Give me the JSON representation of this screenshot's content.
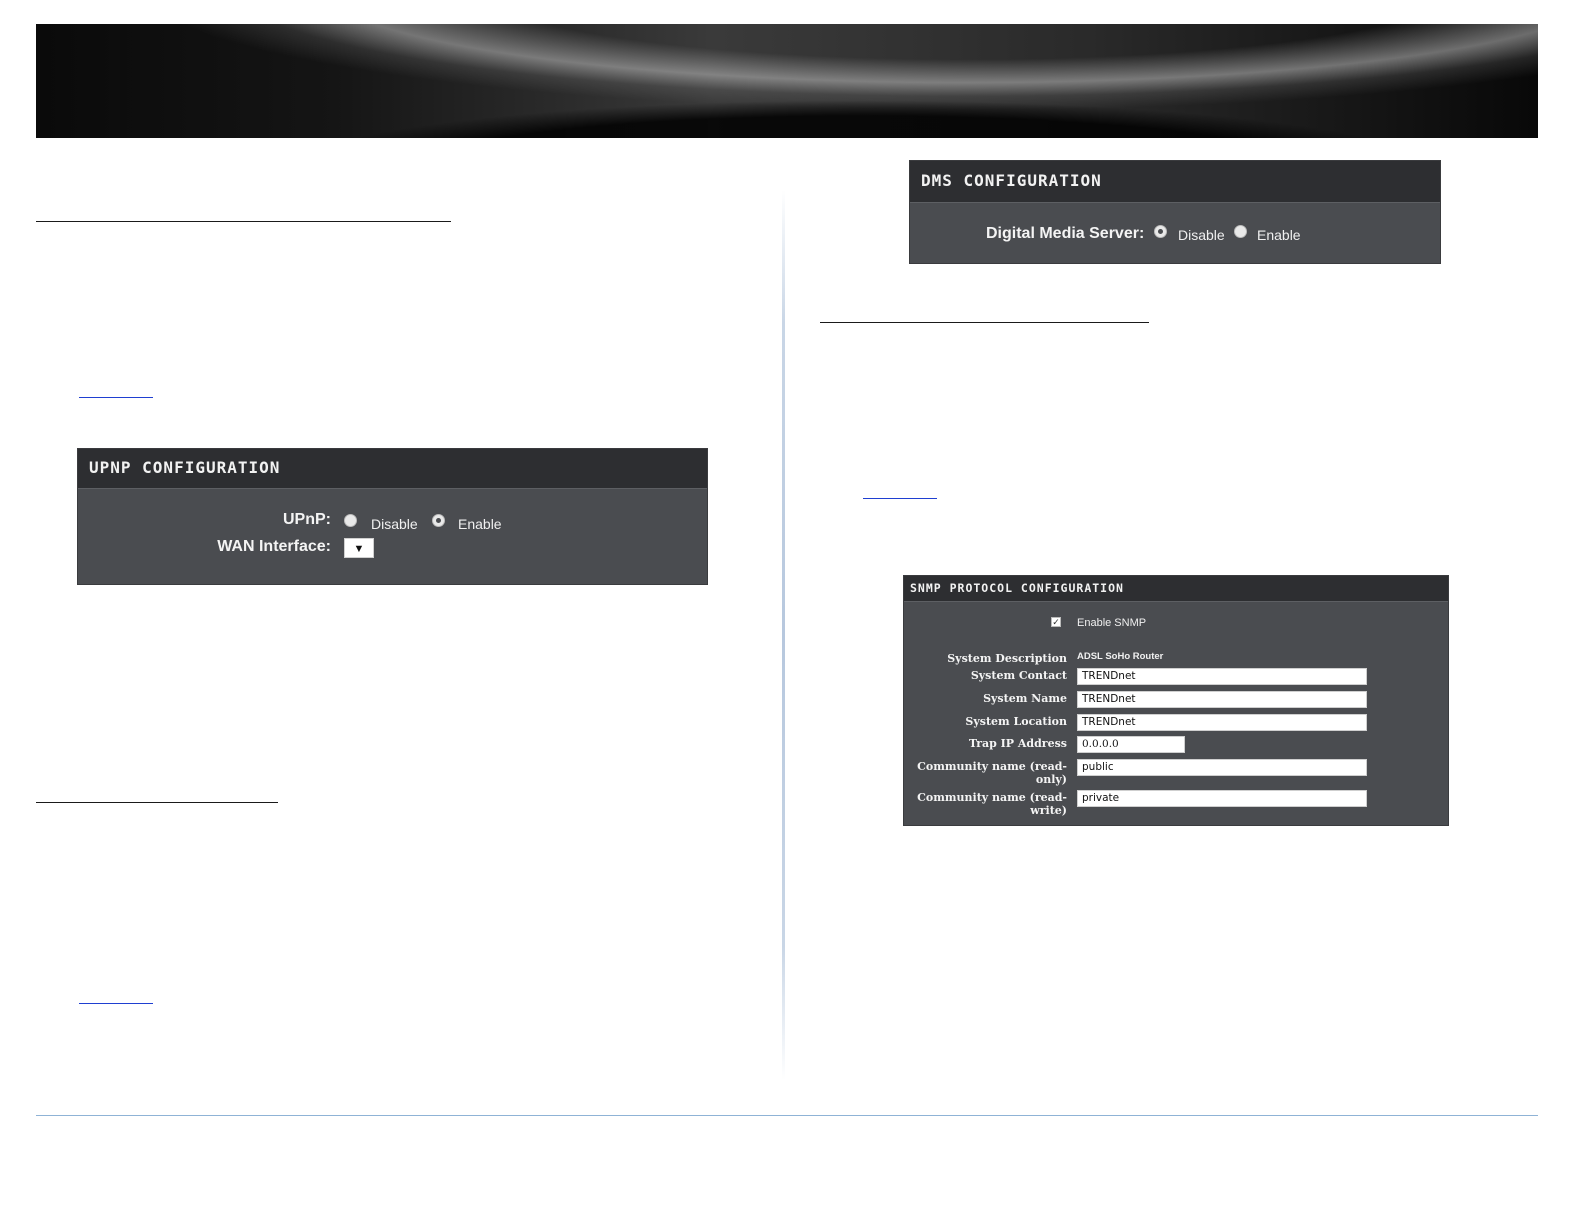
{
  "upnp": {
    "title": "UPNP CONFIGURATION",
    "upnp_label": "UPnP:",
    "disable": "Disable",
    "enable": "Enable",
    "selected": "Enable",
    "wan_label": "WAN Interface:",
    "wan_select_arrow": "▼"
  },
  "dms": {
    "title": "DMS CONFIGURATION",
    "server_label": "Digital Media Server:",
    "disable": "Disable",
    "enable": "Enable",
    "selected": "Disable"
  },
  "snmp": {
    "title": "SNMP PROTOCOL CONFIGURATION",
    "enable_label": "Enable SNMP",
    "enable_checked": true,
    "system_description_label": "System Description",
    "system_description_value": "ADSL SoHo Router",
    "system_contact_label": "System Contact",
    "system_contact_value": "TRENDnet",
    "system_name_label": "System Name",
    "system_name_value": "TRENDnet",
    "system_location_label": "System Location",
    "system_location_value": "TRENDnet",
    "trap_ip_label": "Trap IP Address",
    "trap_ip_value": "0.0.0.0",
    "community_ro_label_1": "Community name (read-",
    "community_ro_label_2": "only)",
    "community_ro_value": "public",
    "community_rw_label_1": "Community name (read-",
    "community_rw_label_2": "write)",
    "community_rw_value": "private"
  },
  "icons": {
    "checkbox": "checkbox-checked-icon",
    "select_arrow": "chevron-down-icon"
  },
  "colors": {
    "panel_bg": "#4a4c50",
    "panel_header": "#2d2e31",
    "link": "#1f3fd1",
    "footer_rule": "#8fb3d6"
  }
}
